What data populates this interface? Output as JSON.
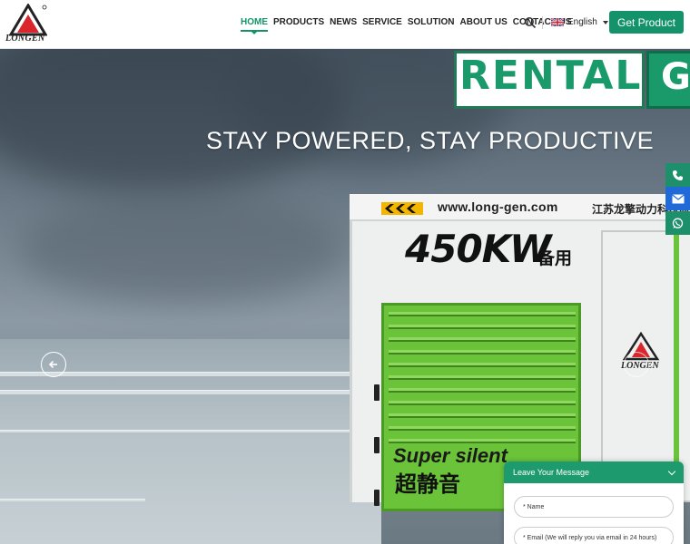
{
  "brand": {
    "logo_text": "LONGEN",
    "accent": "#14936b"
  },
  "nav": {
    "items": [
      {
        "label": "HOME"
      },
      {
        "label": "PRODUCTS"
      },
      {
        "label": "NEWS"
      },
      {
        "label": "SERVICE"
      },
      {
        "label": "SOLUTION"
      },
      {
        "label": "ABOUT US"
      },
      {
        "label": "CONTACT US"
      }
    ],
    "active": "HOME",
    "search_icon": "search-icon",
    "language": "English",
    "cta": "Get Product"
  },
  "hero": {
    "sign_word": "RENTAL",
    "sign_word_partial": "GE",
    "tagline": "STAY POWERED, STAY PRODUCTIVE",
    "container_url": "www.long-gen.com",
    "container_company_cn": "江苏龙擎动力科技股",
    "power_label": "450KW",
    "power_label_cn": "备用",
    "silent_label": "Super silent",
    "silent_label_cn": "超静音",
    "door_logo_text": "LONGEN"
  },
  "side_contact": {
    "items": [
      {
        "icon": "phone-icon",
        "color": "#1d8f6a"
      },
      {
        "icon": "email-icon",
        "color": "#1f6ad8"
      },
      {
        "icon": "whatsapp-icon",
        "color": "#1d8f6a"
      }
    ]
  },
  "chat": {
    "title": "Leave Your Message",
    "name_placeholder": "* Name",
    "email_placeholder": "* Email (We will reply you via email in 24 hours)"
  }
}
